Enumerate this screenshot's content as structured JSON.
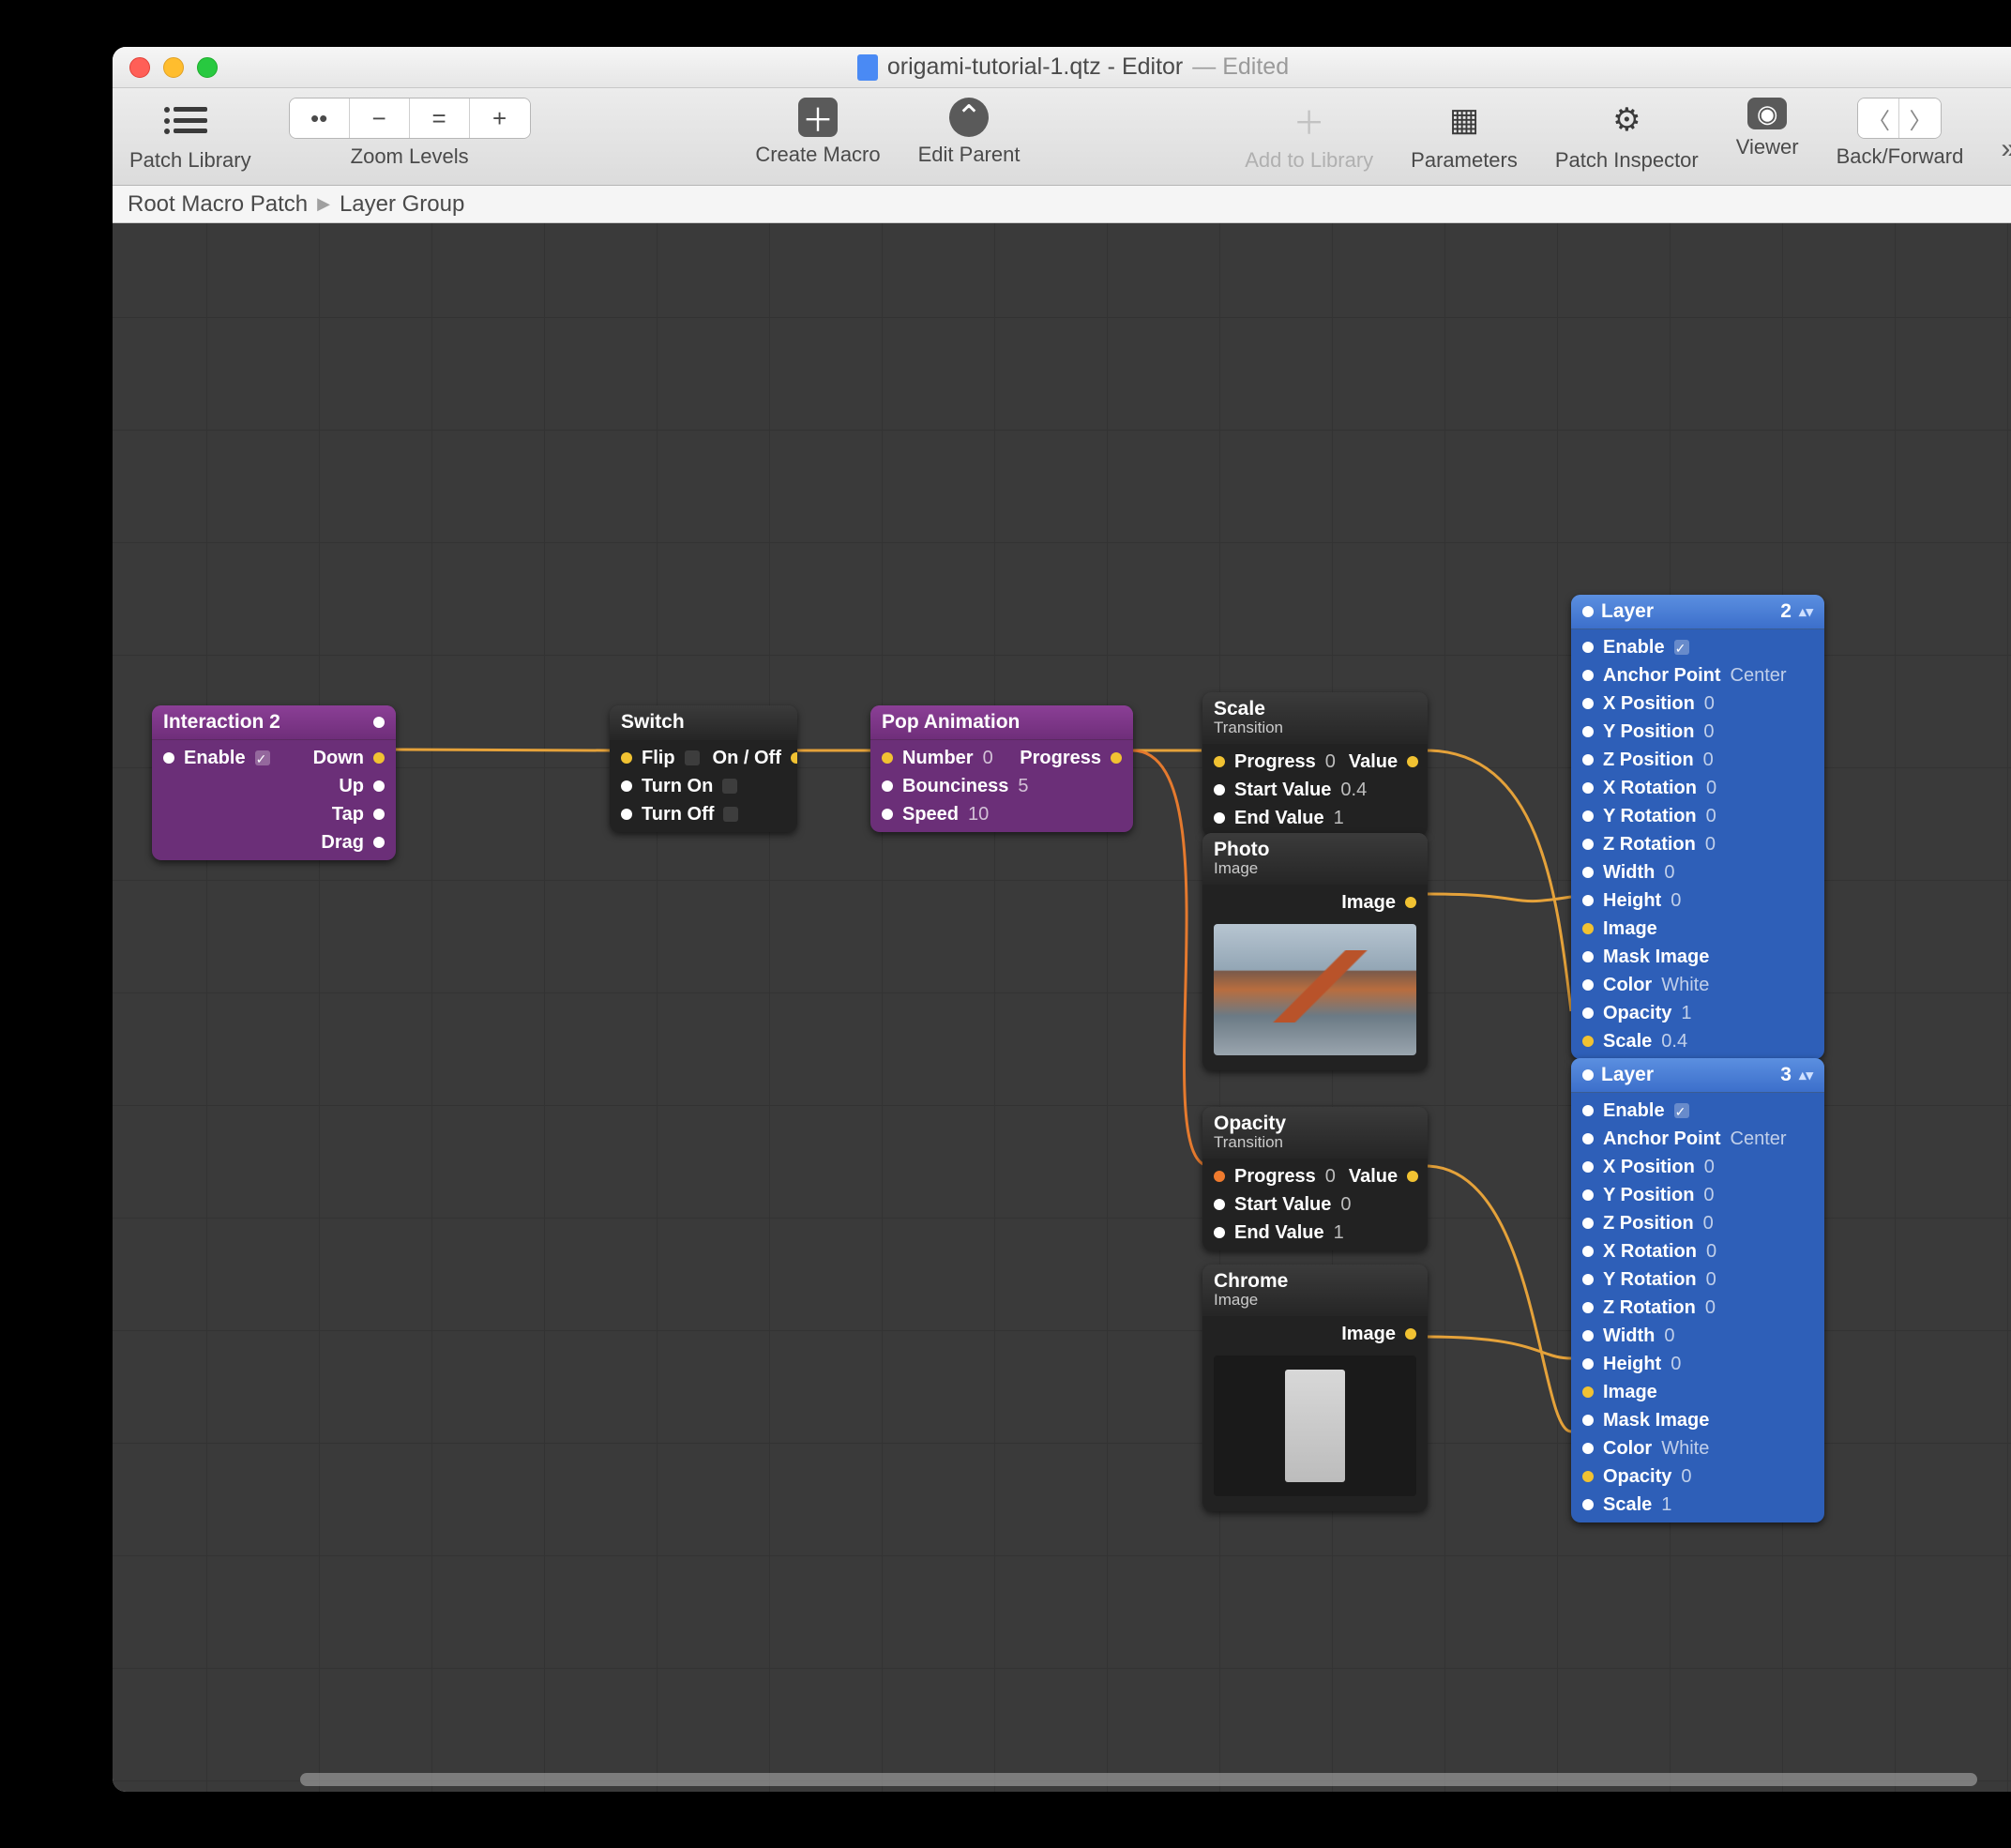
{
  "window": {
    "filename": "origami-tutorial-1.qtz - Editor",
    "edited": "— Edited"
  },
  "toolbar": {
    "patch_library": "Patch Library",
    "zoom_levels": "Zoom Levels",
    "zoom_buttons": [
      "••",
      "−",
      "=",
      "+"
    ],
    "create_macro": "Create Macro",
    "edit_parent": "Edit Parent",
    "add_to_library": "Add to Library",
    "parameters": "Parameters",
    "patch_inspector": "Patch Inspector",
    "viewer": "Viewer",
    "back_forward": "Back/Forward"
  },
  "breadcrumb": {
    "root": "Root Macro Patch",
    "leaf": "Layer Group"
  },
  "nodes": {
    "interaction": {
      "title": "Interaction 2",
      "enable": "Enable",
      "down": "Down",
      "up": "Up",
      "tap": "Tap",
      "drag": "Drag"
    },
    "switch": {
      "title": "Switch",
      "flip": "Flip",
      "onoff": "On / Off",
      "turn_on": "Turn On",
      "turn_off": "Turn Off"
    },
    "pop": {
      "title": "Pop Animation",
      "number": "Number",
      "number_v": "0",
      "bounciness": "Bounciness",
      "bounciness_v": "5",
      "speed": "Speed",
      "speed_v": "10",
      "progress": "Progress"
    },
    "scale": {
      "title": "Scale",
      "sub": "Transition",
      "progress": "Progress",
      "progress_v": "0",
      "start": "Start Value",
      "start_v": "0.4",
      "end": "End Value",
      "end_v": "1",
      "value": "Value"
    },
    "photo": {
      "title": "Photo",
      "sub": "Image",
      "image": "Image"
    },
    "opacity": {
      "title": "Opacity",
      "sub": "Transition",
      "progress": "Progress",
      "progress_v": "0",
      "start": "Start Value",
      "start_v": "0",
      "end": "End Value",
      "end_v": "1",
      "value": "Value"
    },
    "chrome": {
      "title": "Chrome",
      "sub": "Image",
      "image": "Image"
    },
    "layer1": {
      "title": "Layer",
      "index": "2",
      "enable": "Enable",
      "anchor": "Anchor Point",
      "anchor_v": "Center",
      "xpos": "X Position",
      "xpos_v": "0",
      "ypos": "Y Position",
      "ypos_v": "0",
      "zpos": "Z Position",
      "zpos_v": "0",
      "xrot": "X Rotation",
      "xrot_v": "0",
      "yrot": "Y Rotation",
      "yrot_v": "0",
      "zrot": "Z Rotation",
      "zrot_v": "0",
      "width": "Width",
      "width_v": "0",
      "height": "Height",
      "height_v": "0",
      "image": "Image",
      "mask": "Mask Image",
      "color": "Color",
      "color_v": "White",
      "opacity": "Opacity",
      "opacity_v": "1",
      "scale": "Scale",
      "scale_v": "0.4"
    },
    "layer2": {
      "title": "Layer",
      "index": "3",
      "enable": "Enable",
      "anchor": "Anchor Point",
      "anchor_v": "Center",
      "xpos": "X Position",
      "xpos_v": "0",
      "ypos": "Y Position",
      "ypos_v": "0",
      "zpos": "Z Position",
      "zpos_v": "0",
      "xrot": "X Rotation",
      "xrot_v": "0",
      "yrot": "Y Rotation",
      "yrot_v": "0",
      "zrot": "Z Rotation",
      "zrot_v": "0",
      "width": "Width",
      "width_v": "0",
      "height": "Height",
      "height_v": "0",
      "image": "Image",
      "mask": "Mask Image",
      "color": "Color",
      "color_v": "White",
      "opacity": "Opacity",
      "opacity_v": "0",
      "scale": "Scale",
      "scale_v": "1"
    }
  }
}
